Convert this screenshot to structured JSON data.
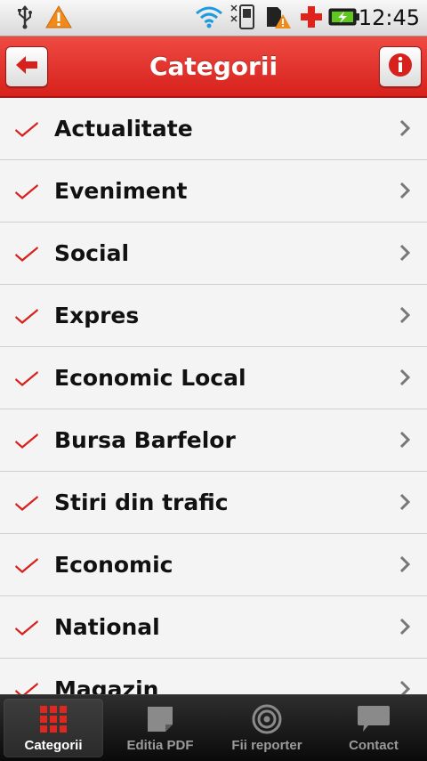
{
  "status_bar": {
    "time": "12:45",
    "icons": [
      "usb-icon",
      "warning-icon",
      "wifi-icon",
      "sim-icon",
      "sd-card-warning-icon",
      "red-cross-icon",
      "battery-charging-icon"
    ]
  },
  "header": {
    "title": "Categorii",
    "back_icon": "arrow-left-icon",
    "info_icon": "info-icon",
    "accent_color": "#dd2a24"
  },
  "categories": [
    {
      "label": "Actualitate"
    },
    {
      "label": "Eveniment"
    },
    {
      "label": "Social"
    },
    {
      "label": "Expres"
    },
    {
      "label": "Economic Local"
    },
    {
      "label": "Bursa Barfelor"
    },
    {
      "label": "Stiri din trafic"
    },
    {
      "label": "Economic"
    },
    {
      "label": "National"
    },
    {
      "label": "Magazin"
    }
  ],
  "tabs": [
    {
      "label": "Categorii",
      "icon": "grid-icon",
      "selected": true
    },
    {
      "label": "Editia PDF",
      "icon": "document-icon",
      "selected": false
    },
    {
      "label": "Fii reporter",
      "icon": "target-icon",
      "selected": false
    },
    {
      "label": "Contact",
      "icon": "speech-bubble-icon",
      "selected": false
    }
  ]
}
